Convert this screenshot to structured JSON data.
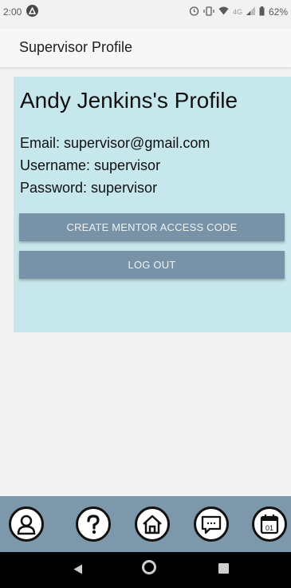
{
  "status_bar": {
    "time": "2:00",
    "network": "4G",
    "battery": "62%"
  },
  "header": {
    "title": "Supervisor Profile"
  },
  "profile": {
    "name_heading": "Andy Jenkins's Profile",
    "email_line": "Email: supervisor@gmail.com",
    "username_line": "Username: supervisor",
    "password_line": "Password: supervisor",
    "create_code_label": "CREATE MENTOR ACCESS CODE",
    "logout_label": "LOG OUT"
  },
  "bottom_nav": {
    "calendar_day": "01",
    "items": [
      "profile-icon",
      "help-icon",
      "home-icon",
      "chat-icon",
      "calendar-icon"
    ]
  },
  "colors": {
    "card_bg": "#c6e7eb",
    "button_bg": "#7892a7",
    "nav_bg": "#7e98ab"
  }
}
